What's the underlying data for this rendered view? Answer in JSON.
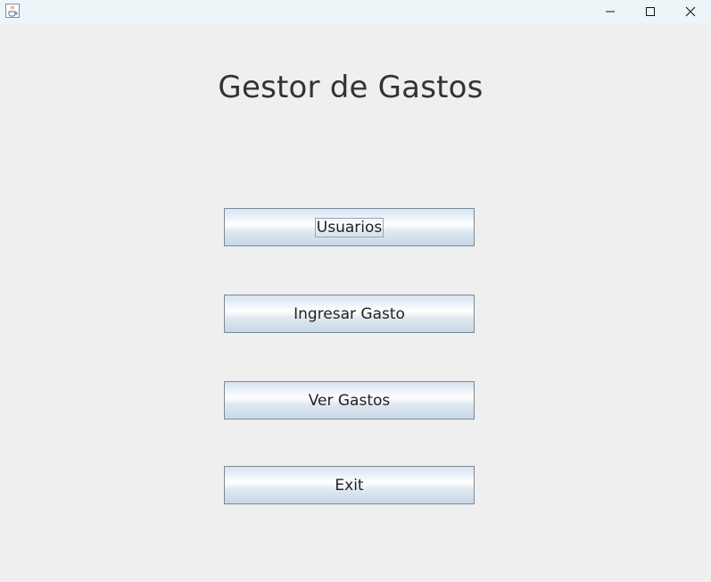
{
  "window": {
    "title_icon": "java-coffee-cup-icon",
    "controls": {
      "minimize_icon": "minimize-icon",
      "maximize_icon": "maximize-icon",
      "close_icon": "close-icon"
    }
  },
  "main": {
    "title": "Gestor de Gastos",
    "buttons": [
      {
        "label": "Usuarios",
        "focused": true
      },
      {
        "label": "Ingresar Gasto",
        "focused": false
      },
      {
        "label": "Ver Gastos",
        "focused": false
      },
      {
        "label": "Exit",
        "focused": false
      }
    ]
  },
  "colors": {
    "window_bg": "#efefef",
    "titlebar_bg": "#eef5f8",
    "button_border": "#7a8a99",
    "title_text": "#333333"
  }
}
